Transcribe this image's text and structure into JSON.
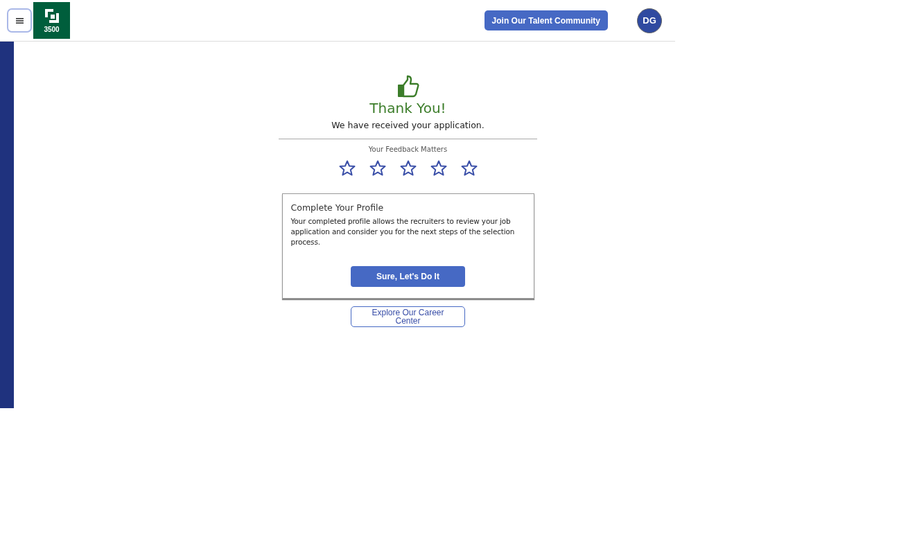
{
  "header": {
    "logo_text": "3500",
    "join_button": "Join Our Talent Community",
    "avatar": "DG"
  },
  "confirmation": {
    "title": "Thank You!",
    "subtitle": "We have received your application."
  },
  "feedback": {
    "label": "Your Feedback Matters",
    "stars": 0
  },
  "profile_card": {
    "title": "Complete Your Profile",
    "text": "Your completed profile allows the recruiters to review your job application and consider you for the next steps of the selection process.",
    "button": "Sure, Let's Do It"
  },
  "career_button": "Explore Our Career Center"
}
